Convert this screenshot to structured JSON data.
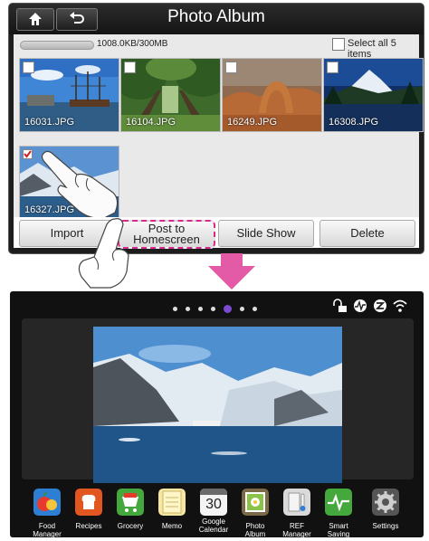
{
  "photo_album": {
    "title": "Photo Album",
    "storage": {
      "used_text": "1008.0KB/300MB",
      "fill": 0.01
    },
    "select_all_label": "Select all 5 items",
    "photos": [
      {
        "filename": "16031.JPG",
        "checked": false
      },
      {
        "filename": "16104.JPG",
        "checked": false
      },
      {
        "filename": "16249.JPG",
        "checked": false
      },
      {
        "filename": "16308.JPG",
        "checked": false
      },
      {
        "filename": "16327.JPG",
        "checked": true
      }
    ],
    "actions": {
      "import": "Import",
      "post_line1": "Post to",
      "post_line2": "Homescreen",
      "slideshow": "Slide Show",
      "delete": "Delete"
    }
  },
  "homescreen": {
    "page_count": 7,
    "active_page": 5,
    "status_icons": [
      "lock-icon",
      "pulse-icon",
      "z-icon",
      "wifi-icon"
    ],
    "apps": [
      {
        "line1": "Food",
        "line2": "Manager",
        "icon": "food-manager-icon"
      },
      {
        "line1": "Recipes",
        "line2": "",
        "icon": "recipes-icon"
      },
      {
        "line1": "Grocery",
        "line2": "",
        "icon": "grocery-icon"
      },
      {
        "line1": "Memo",
        "line2": "",
        "icon": "memo-icon"
      },
      {
        "line1": "Google",
        "line2": "Calendar",
        "icon": "calendar-icon",
        "calendar_day": "30"
      },
      {
        "line1": "Photo",
        "line2": "Album",
        "icon": "photo-album-icon"
      },
      {
        "line1": "REF",
        "line2": "Manager",
        "icon": "ref-manager-icon"
      },
      {
        "line1": "Smart",
        "line2": "Saving",
        "icon": "smart-saving-icon"
      },
      {
        "line1": "Settings",
        "line2": "",
        "icon": "settings-icon"
      }
    ]
  },
  "colors": {
    "highlight": "#d62a8e",
    "arrow": "#e35aa7",
    "active_dot": "#7a4bd1"
  }
}
